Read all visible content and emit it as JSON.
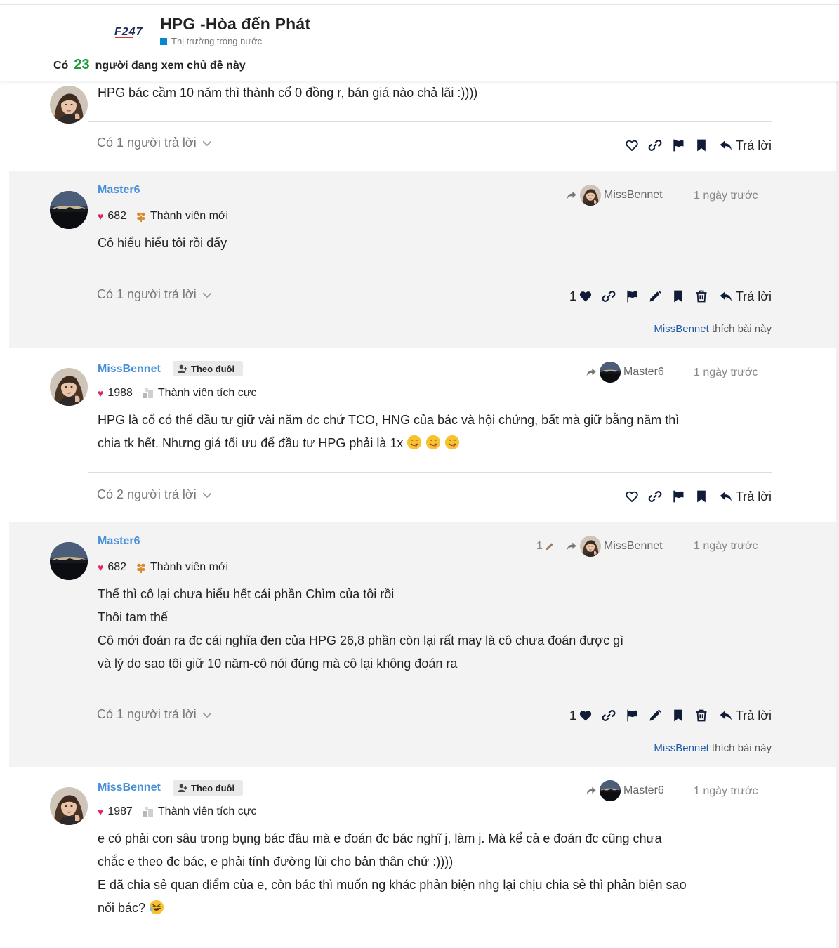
{
  "header": {
    "logo_text": "F247",
    "title": "HPG -Hòa đến Phát",
    "category": "Thị trường trong nước",
    "viewers_prefix": "Có",
    "viewers_count": "23",
    "viewers_suffix": "người đang xem chủ đề này",
    "category_color": "#0a86cd"
  },
  "colors": {
    "username": "#4a90d9",
    "viewer_count": "#1d9a3b",
    "liked_by_user": "#1f5ba8",
    "heart": "#e0245e",
    "post_gray_bg": "#f3f3f3"
  },
  "posts": [
    {
      "body": "HPG bác cầm 10 năm thì thành cổ 0 đồng r, bán giá nào chả lãi :))))",
      "replies": "Có 1 người trả lời",
      "reply_label": "Trả lời"
    },
    {
      "username": "Master6",
      "likes": "682",
      "rank": "Thành viên mới",
      "reply_to": "MissBennet",
      "time": "1 ngày trước",
      "body": "Cô hiểu hiểu tôi rồi đấy",
      "replies": "Có 1 người trả lời",
      "like_count": "1",
      "reply_label": "Trả lời",
      "liked_by_user": "MissBennet",
      "liked_by_suffix": "thích bài này"
    },
    {
      "username": "MissBennet",
      "follow_label": "Theo đuôi",
      "likes": "1988",
      "rank": "Thành viên tích cực",
      "reply_to": "Master6",
      "time": "1 ngày trước",
      "body_lines": [
        "HPG là cổ có thể đầu tư giữ vài năm đc chứ TCO, HNG của bác và hội chứng, bất mà giữ bằng năm thì",
        "chia tk hết. Nhưng giá tối ưu để đầu tư HPG phải là 1x"
      ],
      "replies": "Có 2 người trả lời",
      "reply_label": "Trả lời"
    },
    {
      "username": "Master6",
      "likes": "682",
      "rank": "Thành viên mới",
      "edit_count": "1",
      "reply_to": "MissBennet",
      "time": "1 ngày trước",
      "body_lines": [
        "Thế thì cô lại chưa hiểu hết cái phần Chìm của tôi rồi",
        "Thôi tam thế",
        "Cô mới đoán ra đc cái nghĩa đen của HPG 26,8 phần còn lại rất may là cô chưa đoán được gì",
        "và lý do sao tôi giữ 10 năm-cô nói đúng mà cô lại không đoán ra"
      ],
      "replies": "Có 1 người trả lời",
      "like_count": "1",
      "reply_label": "Trả lời",
      "liked_by_user": "MissBennet",
      "liked_by_suffix": "thích bài này"
    },
    {
      "username": "MissBennet",
      "follow_label": "Theo đuôi",
      "likes": "1987",
      "rank": "Thành viên tích cực",
      "reply_to": "Master6",
      "time": "1 ngày trước",
      "body_lines": [
        "e có phải con sâu trong bụng bác đâu mà e đoán đc bác nghĩ j, làm j. Mà kể cả e đoán đc cũng chưa",
        "chắc e theo đc bác, e phải tính đường lùi cho bản thân chứ :))))",
        "E đã chia sẻ quan điểm của e, còn bác thì muốn ng khác phản biện nhg lại chịu chia sẻ thì phản biện sao",
        "nổi bác?"
      ]
    }
  ]
}
